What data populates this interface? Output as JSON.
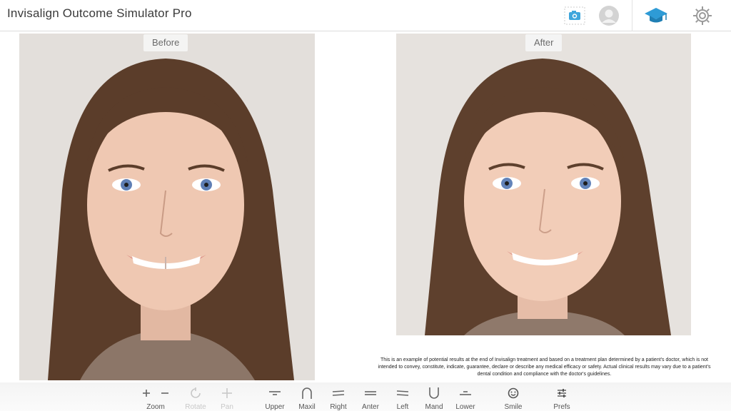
{
  "app": {
    "title": "Invisalign Outcome Simulator Pro"
  },
  "toolbar_top": {
    "camera_icon": "camera-icon",
    "avatar_icon": "avatar-icon",
    "education_icon": "graduation-cap-icon",
    "settings_icon": "gear-icon"
  },
  "panes": {
    "before_label": "Before",
    "after_label": "After"
  },
  "disclaimer": {
    "line1": "This is an example of potential results at the end of Invisalign treatment and based on a treatment plan determined by a patient's doctor, which is not",
    "line2": "intended to convey, constitute, indicate, guarantee, declare or describe any medical efficacy or safety. Actual clinical results may vary due to a patient's",
    "line3": "dental condition and compliance with the doctor's guidelines."
  },
  "bottom_toolbar": {
    "zoom": "Zoom",
    "rotate": "Rotate",
    "pan": "Pan",
    "upper": "Upper",
    "maxil": "Maxil",
    "right": "Right",
    "anter": "Anter",
    "left": "Left",
    "mand": "Mand",
    "lower": "Lower",
    "smile": "Smile",
    "prefs": "Prefs"
  },
  "colors": {
    "accent": "#2e9bd6",
    "toolbar_bg": "#f6f6f6"
  }
}
